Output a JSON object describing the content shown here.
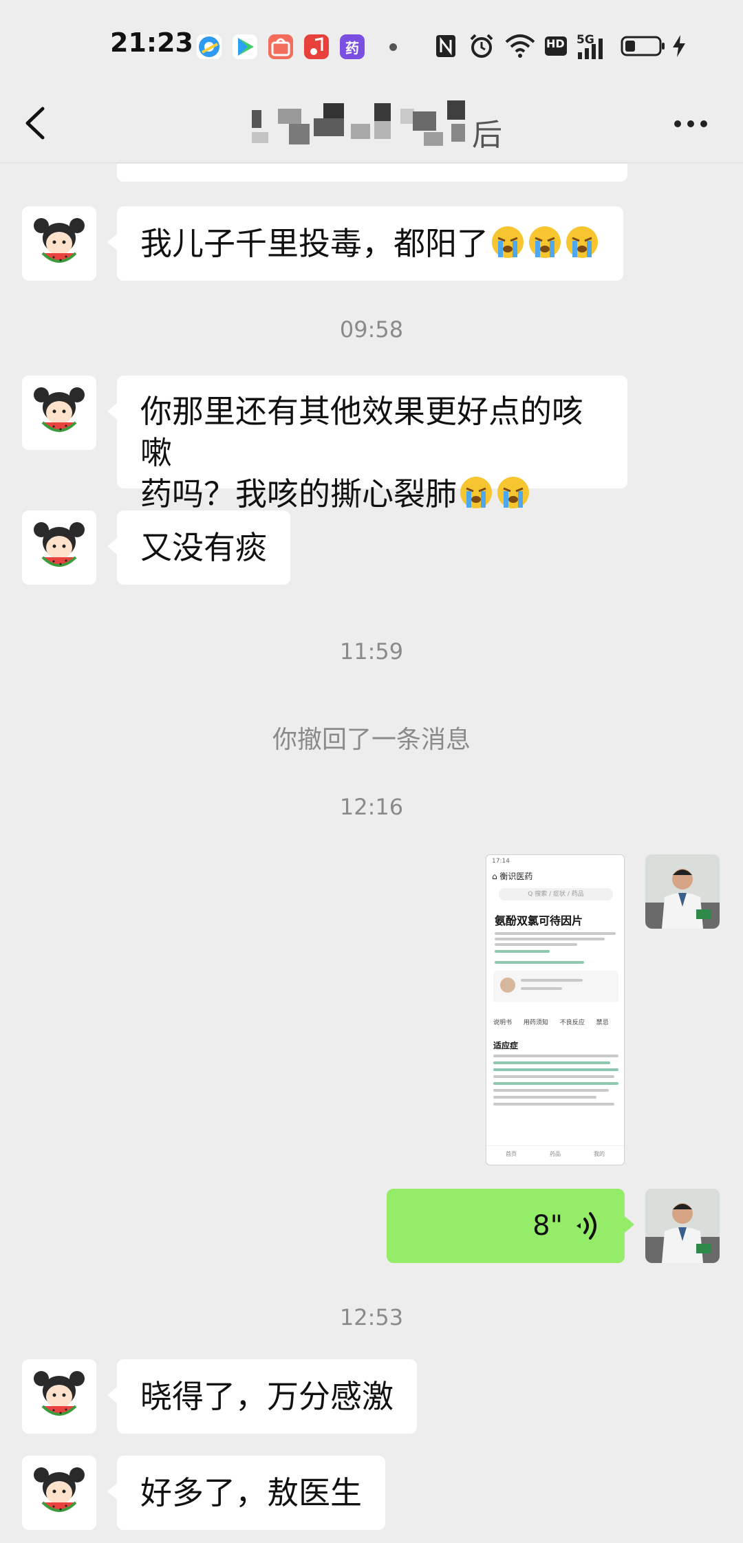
{
  "status_bar": {
    "time": "21:23",
    "app_icons": [
      "qq-browser-icon",
      "video-icon",
      "shopping-icon",
      "music-icon",
      "medicine-app-icon"
    ],
    "medicine_app_glyph": "药",
    "network": "5G",
    "hd": "HD",
    "nfc": "N"
  },
  "nav": {
    "title": "▂▄▀▄▂▆▂▄ 后"
  },
  "messages": [
    {
      "type": "text",
      "from": "contact",
      "text": "我儿子千里投毒，都阳了"
    },
    {
      "type": "time",
      "text": "09:58"
    },
    {
      "type": "text",
      "from": "contact",
      "line1": "你那里还有其他效果更好点的咳嗽",
      "line2": "药吗？我咳的撕心裂肺"
    },
    {
      "type": "text",
      "from": "contact",
      "text": "又没有痰"
    },
    {
      "type": "time",
      "text": "11:59"
    },
    {
      "type": "system",
      "text": "你撤回了一条消息"
    },
    {
      "type": "time",
      "text": "12:16"
    },
    {
      "type": "image",
      "from": "me"
    },
    {
      "type": "voice",
      "from": "me",
      "duration": "8\""
    },
    {
      "type": "time",
      "text": "12:53"
    },
    {
      "type": "text",
      "from": "contact",
      "text": "晓得了，万分感激"
    },
    {
      "type": "text",
      "from": "contact",
      "text": "好多了，敖医生"
    }
  ],
  "shared_image": {
    "status": "17:14",
    "header": "⌂ 衡识医药",
    "search_placeholder": "Q 搜索 / 症状 / 药品",
    "drug_title": "氨酚双氯可待因片",
    "tabs": "说明书 用药须知 不良反应 禁忌",
    "section": "适应症",
    "footer": [
      "首页",
      "药品",
      "我的"
    ]
  },
  "colors": {
    "background": "#ededed",
    "incoming_bubble": "#ffffff",
    "outgoing_bubble": "#95ec69",
    "timestamp": "#8a8a8a"
  }
}
